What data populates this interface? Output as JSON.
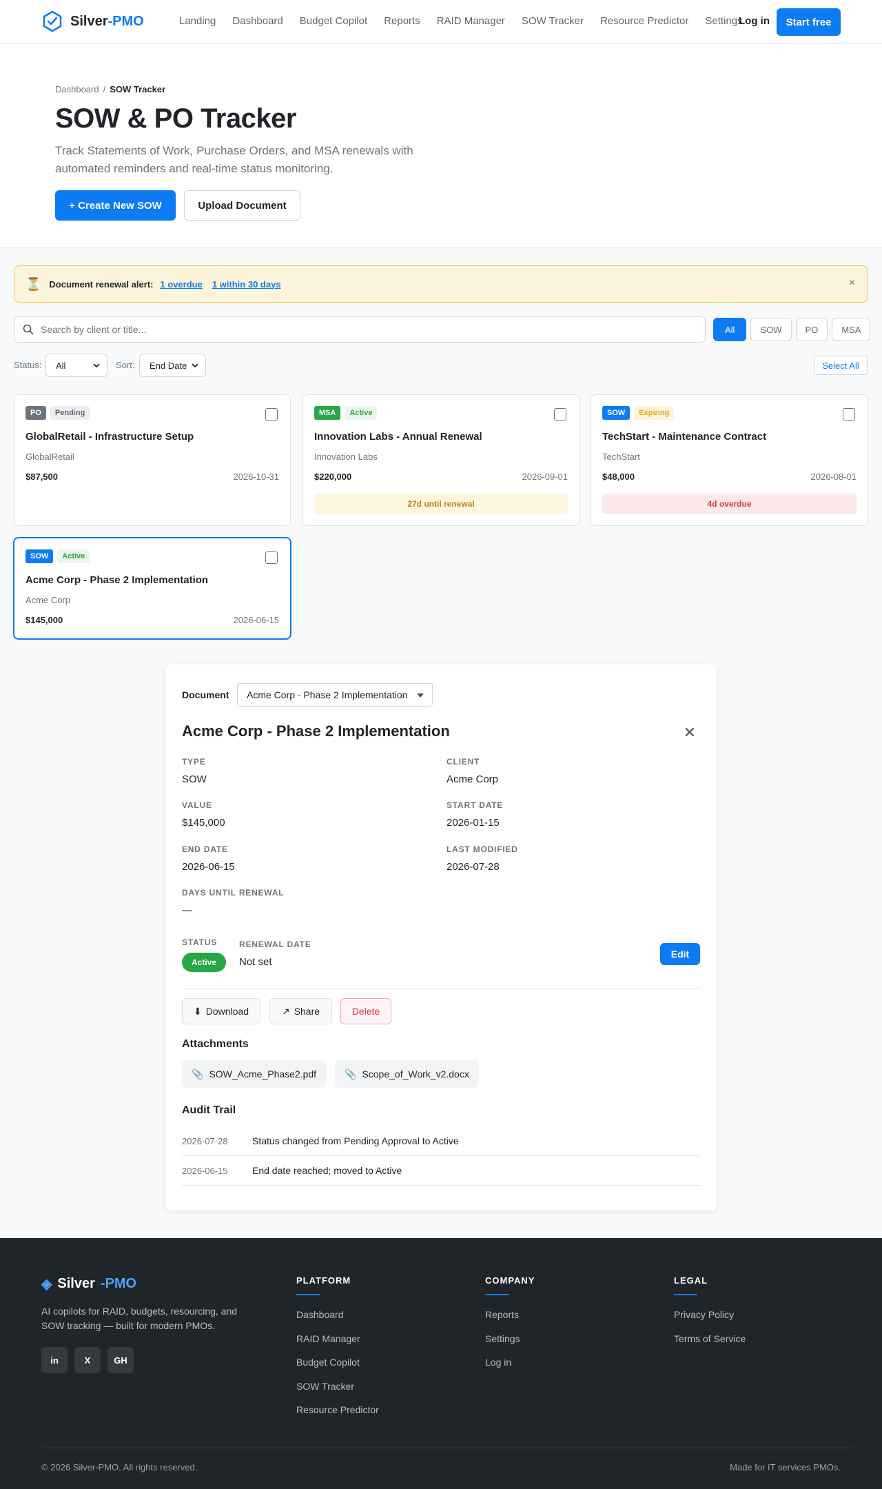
{
  "nav": {
    "brand_main": "Silver",
    "brand_accent": "-PMO",
    "links": [
      "Landing",
      "Dashboard",
      "Budget Copilot",
      "Reports",
      "RAID Manager",
      "SOW Tracker",
      "Resource Predictor",
      "Settings"
    ],
    "login": "Log in",
    "cta": "Start free"
  },
  "hero": {
    "breadcrumb_parent": "Dashboard",
    "breadcrumb_sep": "/",
    "breadcrumb_current": "SOW Tracker",
    "title": "SOW & PO Tracker",
    "subtitle": "Track Statements of Work, Purchase Orders, and MSA renewals with automated reminders and real-time status monitoring.",
    "primary_button": "+ Create New SOW",
    "secondary_button": "Upload Document"
  },
  "alert": {
    "icon": "⏳",
    "label": "Document renewal alert:",
    "link_overdue": "1 overdue",
    "link_soon": "1 within 30 days",
    "close": "×"
  },
  "search": {
    "placeholder": "Search by client or title..."
  },
  "type_filters": [
    "All",
    "SOW",
    "PO",
    "MSA"
  ],
  "controls": {
    "status_label": "Status:",
    "status_value": "All",
    "sort_label": "Sort:",
    "sort_value": "End Date",
    "select_all": "Select All"
  },
  "cards": [
    {
      "type": "PO",
      "status": "Pending",
      "title": "GlobalRetail - Infrastructure Setup",
      "client": "GlobalRetail",
      "value": "$87,500",
      "end_date": "2026-10-31",
      "note": ""
    },
    {
      "type": "MSA",
      "status": "Active",
      "title": "Innovation Labs - Annual Renewal",
      "client": "Innovation Labs",
      "value": "$220,000",
      "end_date": "2026-09-01",
      "note": "27d until renewal"
    },
    {
      "type": "SOW",
      "status": "Expiring",
      "title": "TechStart - Maintenance Contract",
      "client": "TechStart",
      "value": "$48,000",
      "end_date": "2026-08-01",
      "note": "4d overdue"
    },
    {
      "type": "SOW",
      "status": "Active",
      "title": "Acme Corp - Phase 2 Implementation",
      "client": "Acme Corp",
      "value": "$145,000",
      "end_date": "2026-06-15",
      "note": ""
    }
  ],
  "detail": {
    "doc_label": "Document",
    "doc_selected": "Acme Corp - Phase 2 Implementation",
    "title": "Acme Corp - Phase 2 Implementation",
    "close": "✕",
    "fields": {
      "type_label": "TYPE",
      "type": "SOW",
      "client_label": "CLIENT",
      "client": "Acme Corp",
      "value_label": "VALUE",
      "value": "$145,000",
      "start_label": "START DATE",
      "start": "2026-01-15",
      "end_label": "END DATE",
      "end": "2026-06-15",
      "modified_label": "LAST MODIFIED",
      "modified": "2026-07-28",
      "days_label": "DAYS UNTIL RENEWAL",
      "days": "—"
    },
    "status_label": "STATUS",
    "status": "Active",
    "renewal_label": "RENEWAL DATE",
    "renewal": "Not set",
    "edit": "Edit",
    "actions": {
      "download_icon": "⬇",
      "download": "Download",
      "share_icon": "↗",
      "share": "Share",
      "delete": "Delete"
    },
    "attachments_title": "Attachments",
    "attachment_icon": "📎",
    "attachments": [
      "SOW_Acme_Phase2.pdf",
      "Scope_of_Work_v2.docx"
    ],
    "audit_title": "Audit Trail",
    "audit": [
      {
        "date": "2026-07-28",
        "text": "Status changed from Pending Approval to Active"
      },
      {
        "date": "2026-06-15",
        "text": "End date reached; moved to Active"
      }
    ]
  },
  "footer": {
    "brand_icon": "◈",
    "brand_main": "Silver",
    "brand_accent": "-PMO",
    "description": "AI copilots for RAID, budgets, resourcing, and SOW tracking — built for modern PMOs.",
    "social": [
      "in",
      "X",
      "GH"
    ],
    "platform_title": "PLATFORM",
    "platform_links": [
      "Dashboard",
      "RAID Manager",
      "Budget Copilot",
      "SOW Tracker",
      "Resource Predictor"
    ],
    "company_title": "COMPANY",
    "company_links": [
      "Reports",
      "Settings",
      "Log in"
    ],
    "legal_title": "LEGAL",
    "legal_links": [
      "Privacy Policy",
      "Terms of Service"
    ],
    "copyright": "© 2026 Silver-PMO. All rights reserved.",
    "made_for": "Made for IT services PMOs."
  },
  "colors": {
    "primary": "#0d7bf2",
    "success": "#28a745",
    "danger": "#dc3545",
    "warning": "#e3a712",
    "footer_bg": "#212529"
  }
}
